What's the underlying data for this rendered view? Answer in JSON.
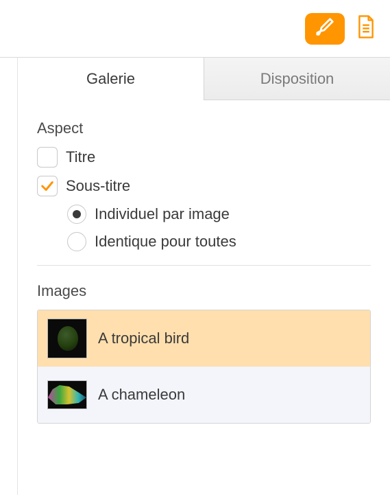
{
  "toolbar": {
    "format_icon": "paintbrush-icon",
    "document_icon": "document-icon"
  },
  "tabs": {
    "gallery": "Galerie",
    "layout": "Disposition"
  },
  "aspect": {
    "heading": "Aspect",
    "title_label": "Titre",
    "title_checked": false,
    "subtitle_label": "Sous-titre",
    "subtitle_checked": true,
    "radio_individual": "Individuel par image",
    "radio_same": "Identique pour toutes",
    "radio_selected": "individual"
  },
  "images": {
    "heading": "Images",
    "items": [
      {
        "caption": "A tropical bird",
        "selected": true
      },
      {
        "caption": "A chameleon",
        "selected": false
      }
    ]
  }
}
